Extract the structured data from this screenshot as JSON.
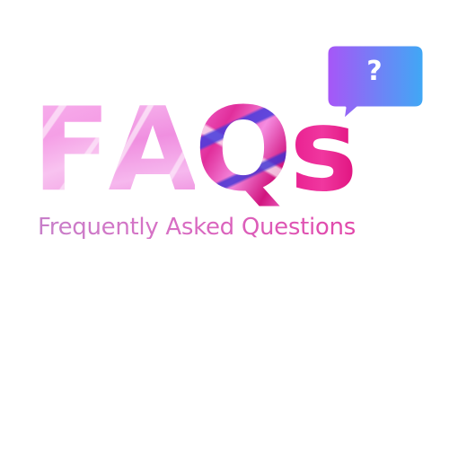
{
  "graphic": {
    "title_letters": [
      "F",
      "A",
      "Q",
      "s"
    ],
    "subtitle": "Frequently Asked Questions",
    "bubble": {
      "symbol": "?",
      "icon": "speech-bubble-icon",
      "gradient": [
        "#a855f7",
        "#3fa9f5"
      ]
    }
  },
  "colors": {
    "pink_light": "#f7b2ee",
    "magenta": "#e81e8f",
    "blue_accent": "#4a3fd8",
    "subtitle": "#c77fc9"
  }
}
